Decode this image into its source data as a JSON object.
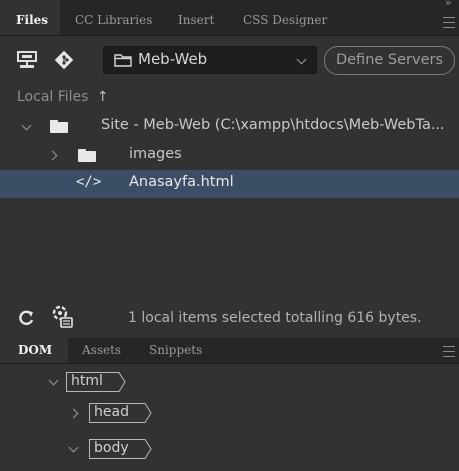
{
  "top_panel": {
    "tabs": [
      {
        "label": "Files",
        "active": true
      },
      {
        "label": "CC Libraries",
        "active": false
      },
      {
        "label": "Insert",
        "active": false
      },
      {
        "label": "CSS Designer",
        "active": false
      }
    ],
    "overflow_glyph": "»"
  },
  "toolbar": {
    "site_name": "Meb-Web",
    "define_servers_label": "Define Servers"
  },
  "local_files": {
    "label": "Local Files",
    "arrow": "↑"
  },
  "tree": {
    "site_label": "Site - Meb-Web (C:\\xampp\\htdocs\\Meb-WebTa...",
    "folder_label": "images",
    "file_label": "Anasayfa.html",
    "file_icon_text": "</>"
  },
  "status": {
    "text": "1 local items selected totalling 616 bytes."
  },
  "dom_panel": {
    "tabs": [
      {
        "label": "DOM",
        "active": true
      },
      {
        "label": "Assets",
        "active": false
      },
      {
        "label": "Snippets",
        "active": false
      }
    ],
    "nodes": [
      {
        "tag": "html"
      },
      {
        "tag": "head"
      },
      {
        "tag": "body"
      }
    ]
  },
  "colors": {
    "panel_bg": "#323232",
    "tab_bar_bg": "#262626",
    "selection_bg": "#3b4e66",
    "text": "#c8c8c8"
  }
}
